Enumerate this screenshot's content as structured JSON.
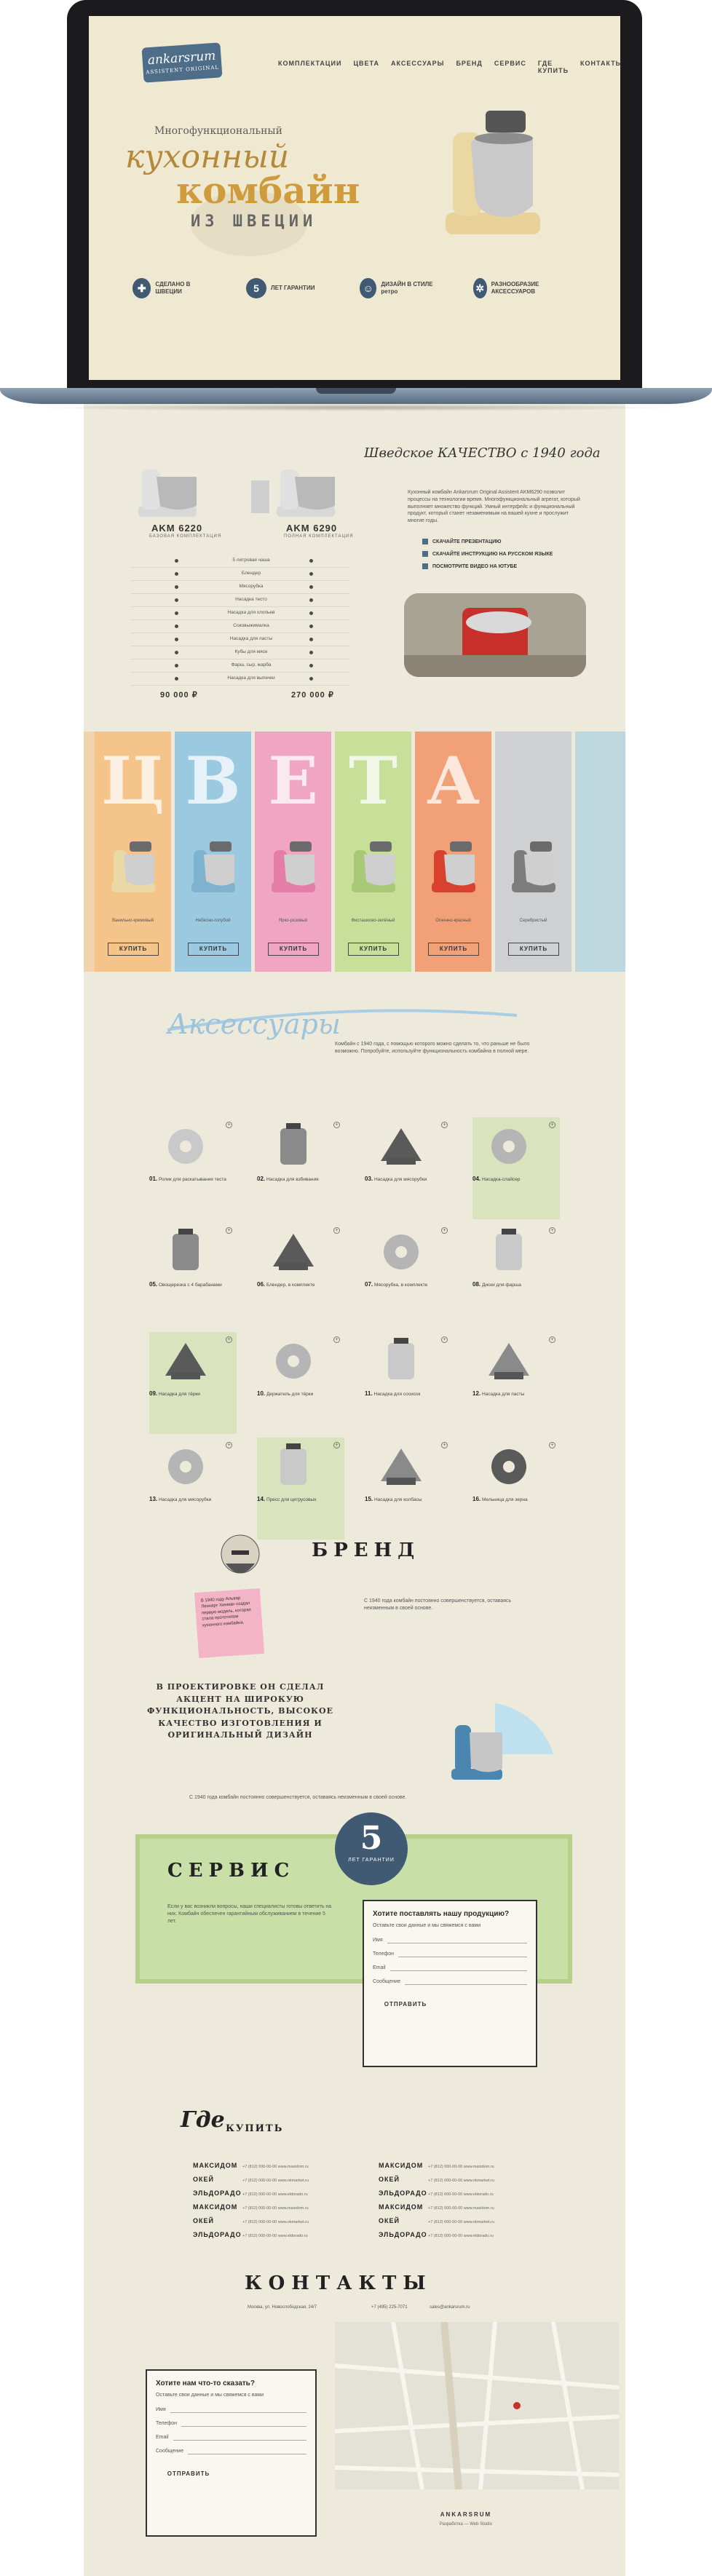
{
  "logo": {
    "brand": "ankarsrum",
    "sub": "ASSISTENT ORIGINAL"
  },
  "nav": [
    "КОМПЛЕКТАЦИИ",
    "ЦВЕТА",
    "АКСЕССУАРЫ",
    "БРЕНД",
    "СЕРВИС",
    "ГДЕ КУПИТЬ",
    "КОНТАКТЫ"
  ],
  "hero": {
    "sub": "Многофункциональный",
    "line1": "кухонный",
    "line2": "комбайн",
    "line3": "ИЗ ШВЕЦИИ",
    "features": [
      {
        "icon": "sweden-flag-icon",
        "glyph": "✚",
        "text": "СДЕЛАНО В ШВЕЦИИ"
      },
      {
        "icon": "five-years-icon",
        "glyph": "5",
        "text": "ЛЕТ ГАРАНТИИ"
      },
      {
        "icon": "retro-style-icon",
        "glyph": "☺",
        "text": "ДИЗАЙН В СТИЛЕ ретро"
      },
      {
        "icon": "accessories-icon",
        "glyph": "✲",
        "text": "РАЗНООБРАЗИЕ АКСЕССУАРОВ"
      }
    ]
  },
  "about": {
    "title": "Шведское КАЧЕСТВО с 1940 года",
    "text": "Кухонный комбайн Ankarsrum Original Assistent AKM6290 позволит процессы на технологии время. Многофункциональный агрегат, который выполняет множество функций. Умный интерфейс и функциональный продукт, который станет незаменимым на вашей кухне и прослужит многие годы.",
    "links": [
      "СКАЧАЙТЕ ПРЕЗЕНТАЦИЮ",
      "СКАЧАЙТЕ ИНСТРУКЦИЮ НА РУССКОМ ЯЗЫКЕ",
      "ПОСМОТРИТЕ ВИДЕО НА ЮТУБЕ"
    ]
  },
  "models": [
    {
      "name": "AKM 6220",
      "sub": "БАЗОВАЯ КОМПЛЕКТАЦИЯ",
      "price": "90 000 ₽"
    },
    {
      "name": "AKM 6290",
      "sub": "ПОЛНАЯ КОМПЛЕКТАЦИЯ",
      "price": "270 000 ₽"
    }
  ],
  "compare": [
    "5 литровая чаша",
    "Блендер",
    "Мясорубка",
    "Насадка тесто",
    "Насадка для хлопьев",
    "Соковыжималка",
    "Насадка для пасты",
    "Кубы для мясе",
    "Фарш, сыр, жарба",
    "Насадка для выпечки"
  ],
  "colors": {
    "title": [
      "Ц",
      "В",
      "Е",
      "Т",
      "А"
    ],
    "items": [
      {
        "name": "Ванильно-кремовый",
        "bg": "#f4c48a",
        "accent": "#e9d9a5"
      },
      {
        "name": "Небесно-голубой",
        "bg": "#9bc9e0",
        "accent": "#7fb2cf"
      },
      {
        "name": "Ярко-розовый",
        "bg": "#f0a6c2",
        "accent": "#e57ea7"
      },
      {
        "name": "Фисташково-зелёный",
        "bg": "#c8df9a",
        "accent": "#a9c878"
      },
      {
        "name": "Огненно-красный",
        "bg": "#f2a078",
        "accent": "#d9412f"
      },
      {
        "name": "Серебристый",
        "bg": "#cfd0d2",
        "accent": "#7c7c7c"
      }
    ],
    "buy": "КУПИТЬ"
  },
  "accessories": {
    "title": "Аксессуары",
    "intro": "Комбайн с 1940 года, с помощью которого можно сделать то, что раньше не было возможно. Попробуйте, используйте функциональность комбайна в полной мере.",
    "items": [
      {
        "num": "01.",
        "text": "Ролик для раскатывания теста"
      },
      {
        "num": "02.",
        "text": "Насадка для взбивания"
      },
      {
        "num": "03.",
        "text": "Насадка для мясорубки"
      },
      {
        "num": "04.",
        "text": "Насадка-слайсер"
      },
      {
        "num": "05.",
        "text": "Овощерезка с 4 барабанами"
      },
      {
        "num": "06.",
        "text": "Блендер, в комплекте"
      },
      {
        "num": "07.",
        "text": "Мясорубка, в комплекте"
      },
      {
        "num": "08.",
        "text": "Диски для фарша"
      },
      {
        "num": "09.",
        "text": "Насадка для тёрки"
      },
      {
        "num": "10.",
        "text": "Держатель для тёрки"
      },
      {
        "num": "11.",
        "text": "Насадка для сосисок"
      },
      {
        "num": "12.",
        "text": "Насадка для пасты"
      },
      {
        "num": "13.",
        "text": "Насадка для мясорубки"
      },
      {
        "num": "14.",
        "text": "Пресс для цитрусовых"
      },
      {
        "num": "15.",
        "text": "Насадка для колбасы"
      },
      {
        "num": "16.",
        "text": "Мельница для зерна"
      }
    ]
  },
  "brand": {
    "title": "БРЕНД",
    "note": "В 1940 году Альвар Леннарт Хинман создал первую модель, которая стала прототипом кухонного комбайна.",
    "quote": "В ПРОЕКТИРОВКЕ ОН СДЕЛАЛ АКЦЕНТ НА ШИРОКУЮ ФУНКЦИОНАЛЬНОСТЬ, ВЫСОКОЕ КАЧЕСТВО ИЗГОТОВЛЕНИЯ И ОРИГИНАЛЬНЫЙ ДИЗАЙН",
    "text": "С 1940 года комбайн постоянно совершенствуется, оставаясь неизменным в своей основе."
  },
  "service": {
    "title": "СЕРВИС",
    "seal_num": "5",
    "seal_text": "ЛЕТ ГАРАНТИИ",
    "text": "Если у вас возникли вопросы, наши специалисты готовы ответить на них. Комбайн обеспечен гарантийным обслуживанием в течение 5 лет.",
    "form": {
      "title": "Хотите поставлять нашу продукцию?",
      "desc": "Оставьте свои данные и мы свяжемся с вами",
      "fields": [
        "Имя",
        "Телефон",
        "Email",
        "Сообщение"
      ],
      "submit": "ОТПРАВИТЬ"
    }
  },
  "where": {
    "title1": "Где",
    "title2": "КУПИТЬ",
    "stores": [
      {
        "name": "МАКСИДОМ",
        "info": "+7 (812) 000-00-00   www.maxidom.ru"
      },
      {
        "name": "ОКЕЙ",
        "info": "+7 (812) 000-00-00   www.okmarket.ru"
      },
      {
        "name": "ЭЛЬДОРАДО",
        "info": "+7 (812) 000-00-00   www.eldorado.ru"
      },
      {
        "name": "МАКСИДОМ",
        "info": "+7 (812) 000-00-00   www.maxidom.ru"
      },
      {
        "name": "ОКЕЙ",
        "info": "+7 (812) 000-00-00   www.okmarket.ru"
      },
      {
        "name": "ЭЛЬДОРАДО",
        "info": "+7 (812) 000-00-00   www.eldorado.ru"
      },
      {
        "name": "МАКСИДОМ",
        "info": "+7 (812) 000-00-00   www.maxidom.ru"
      },
      {
        "name": "ОКЕЙ",
        "info": "+7 (812) 000-00-00   www.okmarket.ru"
      },
      {
        "name": "ЭЛЬДОРАДО",
        "info": "+7 (812) 000-00-00   www.eldorado.ru"
      },
      {
        "name": "МАКСИДОМ",
        "info": "+7 (812) 000-00-00   www.maxidom.ru"
      },
      {
        "name": "ОКЕЙ",
        "info": "+7 (812) 000-00-00   www.okmarket.ru"
      },
      {
        "name": "ЭЛЬДОРАДО",
        "info": "+7 (812) 000-00-00   www.eldorado.ru"
      }
    ]
  },
  "contacts": {
    "title": "КОНТАКТЫ",
    "address": "Москва, ул. Новослободская, 24/7",
    "phone": "+7 (495) 225-7071",
    "email": "sales@ankarsrum.ru",
    "form": {
      "title": "Хотите нам что-то сказать?",
      "desc": "Оставьте свои данные и мы свяжемся с вами",
      "fields": [
        "Имя",
        "Телефон",
        "Email",
        "Сообщение"
      ],
      "submit": "ОТПРАВИТЬ"
    },
    "footer_brand": "ANKARSRUM",
    "footer_note": "Разработка — Web Studio"
  },
  "colors_theme": {
    "blue": "#3f5a72",
    "cream": "#efe9d2",
    "gold": "#cf9b3c",
    "green": "#c9dfa8"
  }
}
